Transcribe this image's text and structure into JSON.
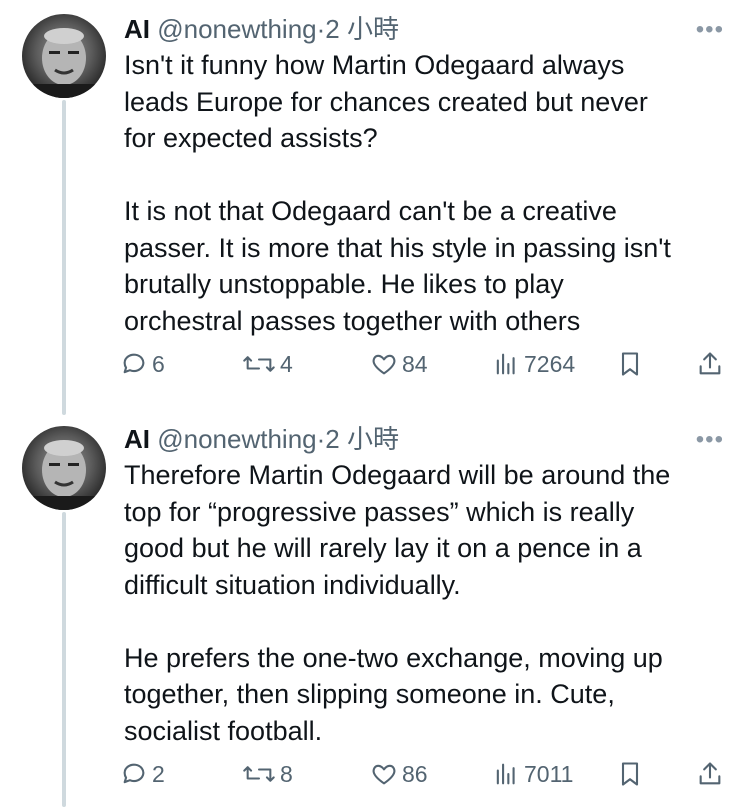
{
  "tweets": [
    {
      "author": {
        "name": "AI",
        "handle": "@nonewthing",
        "separator": "·",
        "time": "2 小時"
      },
      "more_label": "•••",
      "paragraphs": [
        "Isn't it funny how Martin Odegaard always\nleads Europe for chances created but never\nfor expected assists?",
        "It is not that Odegaard can't be a creative\npasser. It is more that his style in passing isn't\nbrutally unstoppable. He likes to play\norchestral passes together with others"
      ],
      "stats": {
        "replies": "6",
        "reposts": "4",
        "likes": "84",
        "views": "7264"
      }
    },
    {
      "author": {
        "name": "AI",
        "handle": "@nonewthing",
        "separator": "·",
        "time": "2 小時"
      },
      "more_label": "•••",
      "paragraphs": [
        "Therefore Martin Odegaard will be around the\ntop for “progressive passes” which is really\ngood but he will rarely lay it on a pence in a\ndifficult situation individually.",
        "He prefers the one-two exchange, moving up\ntogether, then slipping someone in. Cute,\nsocialist football."
      ],
      "stats": {
        "replies": "2",
        "reposts": "8",
        "likes": "86",
        "views": "7011"
      }
    }
  ],
  "colors": {
    "text_primary": "#0f1419",
    "text_secondary": "#536471",
    "thread_line": "#cfd9de"
  },
  "icons": [
    "reply-icon",
    "repost-icon",
    "like-icon",
    "views-icon",
    "bookmark-icon",
    "share-icon",
    "more-icon",
    "avatar"
  ]
}
